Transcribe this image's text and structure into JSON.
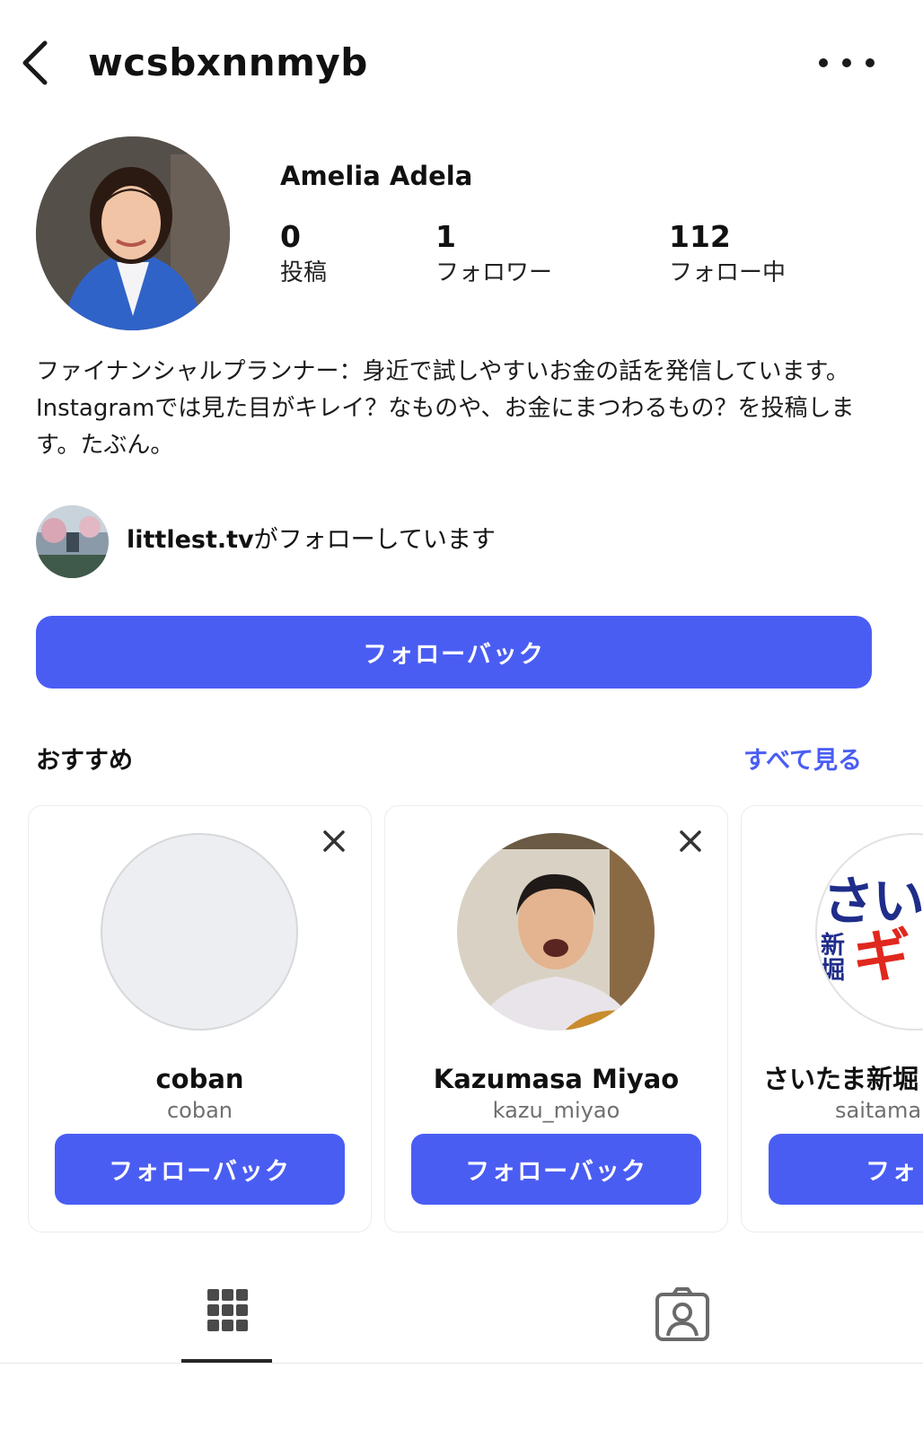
{
  "header": {
    "username": "wcsbxnnmyb",
    "back_icon": "chevron-left-icon",
    "more_icon": "more-horizontal-icon"
  },
  "profile": {
    "display_name": "Amelia Adela",
    "stats": [
      {
        "value": "0",
        "label": "投稿"
      },
      {
        "value": "1",
        "label": "フォロワー"
      },
      {
        "value": "112",
        "label": "フォロー中"
      }
    ],
    "bio": "ファイナンシャルプランナー：身近で試しやすいお金の話を発信しています。Instagramでは見た目がキレイ？なものや、お金にまつわるもの？を投稿します。たぶん。",
    "mutual": {
      "account": "littlest.tv",
      "text": "がフォローしています"
    },
    "follow_button": "フォローバック"
  },
  "suggestions": {
    "title": "おすすめ",
    "see_all": "すべて見る",
    "cards": [
      {
        "name": "coban",
        "handle": "coban",
        "button": "フォローバック"
      },
      {
        "name": "Kazumasa Miyao",
        "handle": "kazu_miyao",
        "button": "フォローバック"
      },
      {
        "name": "さいたま新堀",
        "handle": "saitama",
        "button": "フォ",
        "pic_text_1": "さい",
        "pic_text_2": "新堀",
        "pic_text_3": "ギ"
      }
    ]
  },
  "tabs": [
    {
      "icon": "grid-icon",
      "active": true
    },
    {
      "icon": "tagged-person-icon",
      "active": false
    }
  ],
  "colors": {
    "accent": "#4a5df3",
    "text": "#111111",
    "muted": "#6f6f6f"
  }
}
